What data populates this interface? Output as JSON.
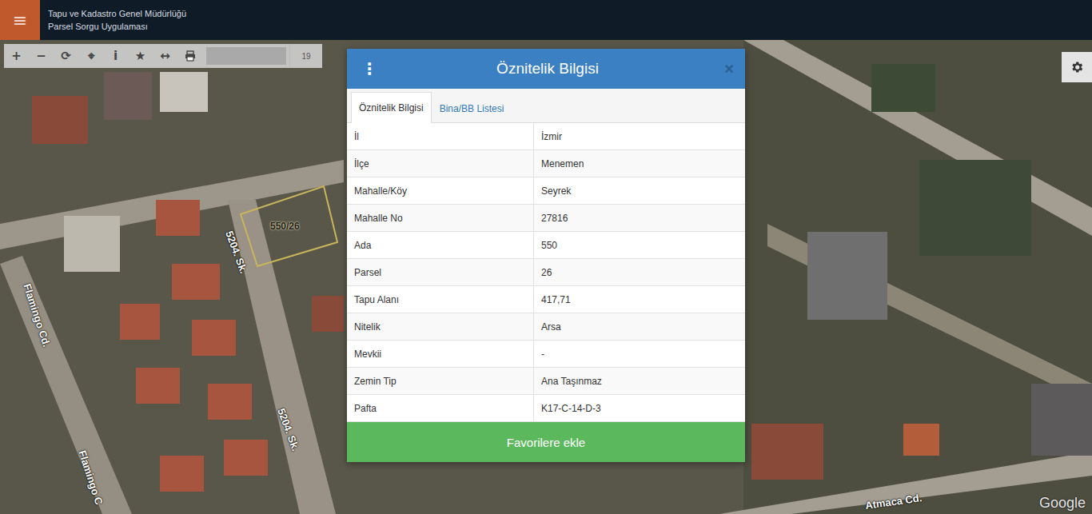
{
  "header": {
    "menu_icon": "≡",
    "title": "Tapu ve Kadastro Genel Müdürlüğü",
    "subtitle": "Parsel Sorgu Uygulaması"
  },
  "toolbar": {
    "buttons": [
      {
        "kind": "glyph",
        "glyph": "+"
      },
      {
        "kind": "glyph",
        "glyph": "−"
      },
      {
        "kind": "glyph",
        "glyph": "⟳"
      },
      {
        "kind": "glyph",
        "glyph": "⌖"
      },
      {
        "kind": "glyph",
        "glyph": "i"
      },
      {
        "kind": "glyph",
        "glyph": "★"
      },
      {
        "kind": "glyph",
        "glyph": "↔"
      },
      {
        "kind": "print"
      }
    ],
    "search": {
      "value": ""
    },
    "zoom": "19"
  },
  "map": {
    "parcel": {
      "label": "550/26"
    },
    "street_labels": [
      "5204. Sk.",
      "5204. Sk.",
      "Flamingo Cd.",
      "Flamingo C",
      "Atmaca Cd."
    ],
    "attribution": "Google"
  },
  "modal": {
    "title": "Öznitelik Bilgisi",
    "more_icon": "⋮",
    "close_icon": "×",
    "tabs": [
      {
        "label": "Öznitelik Bilgisi",
        "selected": true
      },
      {
        "label": "Bina/BB Listesi",
        "selected": false
      }
    ],
    "rows": [
      {
        "label": "İl",
        "value": "İzmir"
      },
      {
        "label": "İlçe",
        "value": "Menemen"
      },
      {
        "label": "Mahalle/Köy",
        "value": "Seyrek"
      },
      {
        "label": "Mahalle No",
        "value": "27816"
      },
      {
        "label": "Ada",
        "value": "550"
      },
      {
        "label": "Parsel",
        "value": "26"
      },
      {
        "label": "Tapu Alanı",
        "value": "417,71"
      },
      {
        "label": "Nitelik",
        "value": "Arsa"
      },
      {
        "label": "Mevkii",
        "value": "-"
      },
      {
        "label": "Zemin Tip",
        "value": "Ana Taşınmaz"
      },
      {
        "label": "Pafta",
        "value": "K17-C-14-D-3"
      }
    ],
    "button": "Favorilere ekle"
  }
}
